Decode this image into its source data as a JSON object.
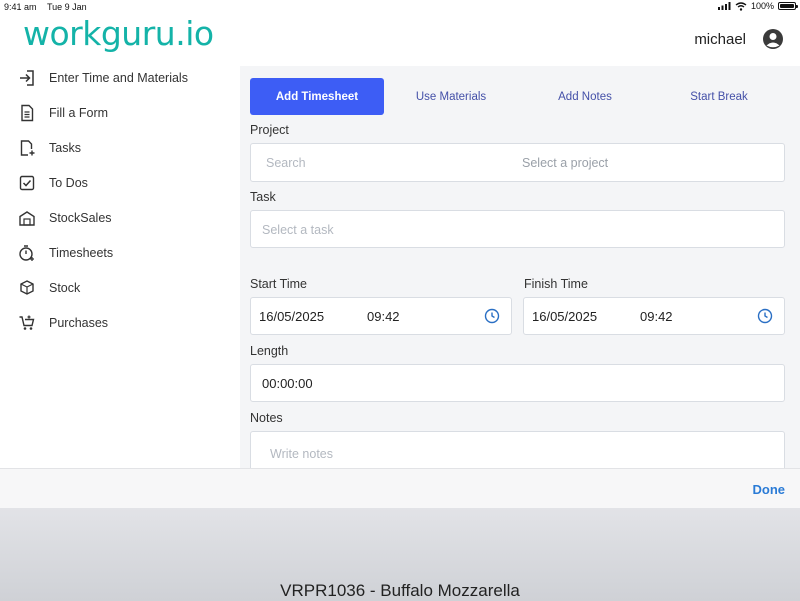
{
  "status_bar": {
    "time": "9:41 am",
    "date": "Tue 9 Jan",
    "battery": "100%",
    "battery_level": 1.0
  },
  "header": {
    "logo": "workguru.io",
    "user": "michael"
  },
  "sidebar": {
    "items": [
      {
        "label": "Enter Time and Materials",
        "icon": "enter-icon"
      },
      {
        "label": "Fill a Form",
        "icon": "document-icon"
      },
      {
        "label": "Tasks",
        "icon": "task-add-icon"
      },
      {
        "label": "To Dos",
        "icon": "checkbox-icon"
      },
      {
        "label": "StockSales",
        "icon": "store-icon"
      },
      {
        "label": "Timesheets",
        "icon": "stopwatch-icon"
      },
      {
        "label": "Stock",
        "icon": "box-icon"
      },
      {
        "label": "Purchases",
        "icon": "cart-icon"
      }
    ]
  },
  "tabs": [
    {
      "label": "Add Timesheet",
      "active": true
    },
    {
      "label": "Use Materials",
      "active": false
    },
    {
      "label": "Add Notes",
      "active": false
    },
    {
      "label": "Start Break",
      "active": false
    }
  ],
  "form": {
    "project_label": "Project",
    "project_search_placeholder": "Search",
    "project_select_placeholder": "Select a project",
    "task_label": "Task",
    "task_placeholder": "Select a task",
    "start_label": "Start Time",
    "start_date": "16/05/2025",
    "start_time": "09:42",
    "finish_label": "Finish Time",
    "finish_date": "16/05/2025",
    "finish_time": "09:42",
    "length_label": "Length",
    "length_value": "00:00:00",
    "notes_label": "Notes",
    "notes_placeholder": "Write notes"
  },
  "toolbar": {
    "done_label": "Done"
  },
  "keyboard": {
    "suggestion": "VRPR1036 - Buffalo Mozzarella"
  },
  "colors": {
    "accent": "#3d5df5",
    "brand": "#14b3a8",
    "link": "#2a7bd6",
    "tab_text": "#4450a8"
  }
}
